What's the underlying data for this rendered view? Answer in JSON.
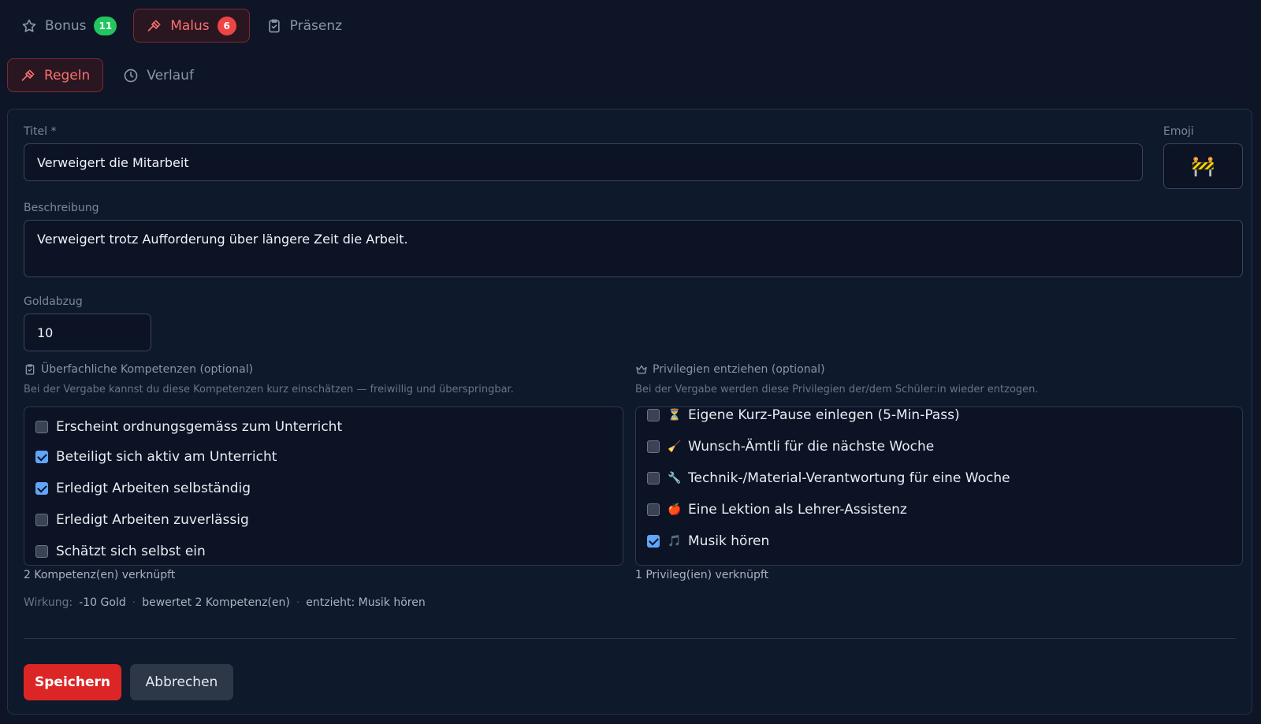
{
  "top_tabs": [
    {
      "label": "Bonus",
      "badge": "11"
    },
    {
      "label": "Malus",
      "badge": "6"
    },
    {
      "label": "Präsenz"
    }
  ],
  "sub_tabs": [
    {
      "label": "Regeln"
    },
    {
      "label": "Verlauf"
    }
  ],
  "form": {
    "title_label": "Titel *",
    "title_value": "Verweigert die Mitarbeit",
    "emoji_label": "Emoji",
    "emoji_value": "🚧",
    "description_label": "Beschreibung",
    "description_value": "Verweigert trotz Aufforderung über längere Zeit die Arbeit.",
    "gold_label": "Goldabzug",
    "gold_value": "10"
  },
  "competencies": {
    "heading": "Überfachliche Kompetenzen (optional)",
    "hint": "Bei der Vergabe kannst du diese Kompetenzen kurz einschätzen — freiwillig und überspringbar.",
    "items": [
      {
        "label": "Erscheint ordnungsgemäss zum Unterricht",
        "checked": false
      },
      {
        "label": "Beteiligt sich aktiv am Unterricht",
        "checked": true
      },
      {
        "label": "Erledigt Arbeiten selbständig",
        "checked": true
      },
      {
        "label": "Erledigt Arbeiten zuverlässig",
        "checked": false
      },
      {
        "label": "Schätzt sich selbst ein",
        "checked": false
      }
    ],
    "count_text": "2 Kompetenz(en) verknüpft"
  },
  "privileges": {
    "heading": "Privilegien entziehen (optional)",
    "hint": "Bei der Vergabe werden diese Privilegien der/dem Schüler:in wieder entzogen.",
    "items": [
      {
        "emoji": "⏳",
        "label": "Eigene Kurz-Pause einlegen (5-Min-Pass)",
        "checked": false
      },
      {
        "emoji": "🧹",
        "label": "Wunsch-Ämtli für die nächste Woche",
        "checked": false
      },
      {
        "emoji": "🔧",
        "label": "Technik-/Material-Verantwortung für eine Woche",
        "checked": false
      },
      {
        "emoji": "🍎",
        "label": "Eine Lektion als Lehrer-Assistenz",
        "checked": false
      },
      {
        "emoji": "🎵",
        "label": "Musik hören",
        "checked": true
      }
    ],
    "count_text": "1 Privileg(ien) verknüpft"
  },
  "effect": {
    "label": "Wirkung:",
    "gold": "-10 Gold",
    "rating": "bewertet 2 Kompetenz(en)",
    "revokes": "entzieht: Musik hören"
  },
  "buttons": {
    "save": "Speichern",
    "cancel": "Abbrechen"
  },
  "colors": {
    "background": "#0d1526",
    "accent_red": "#ef4444",
    "checkbox_blue": "#60a5fa",
    "badge_green": "#22c55e"
  }
}
